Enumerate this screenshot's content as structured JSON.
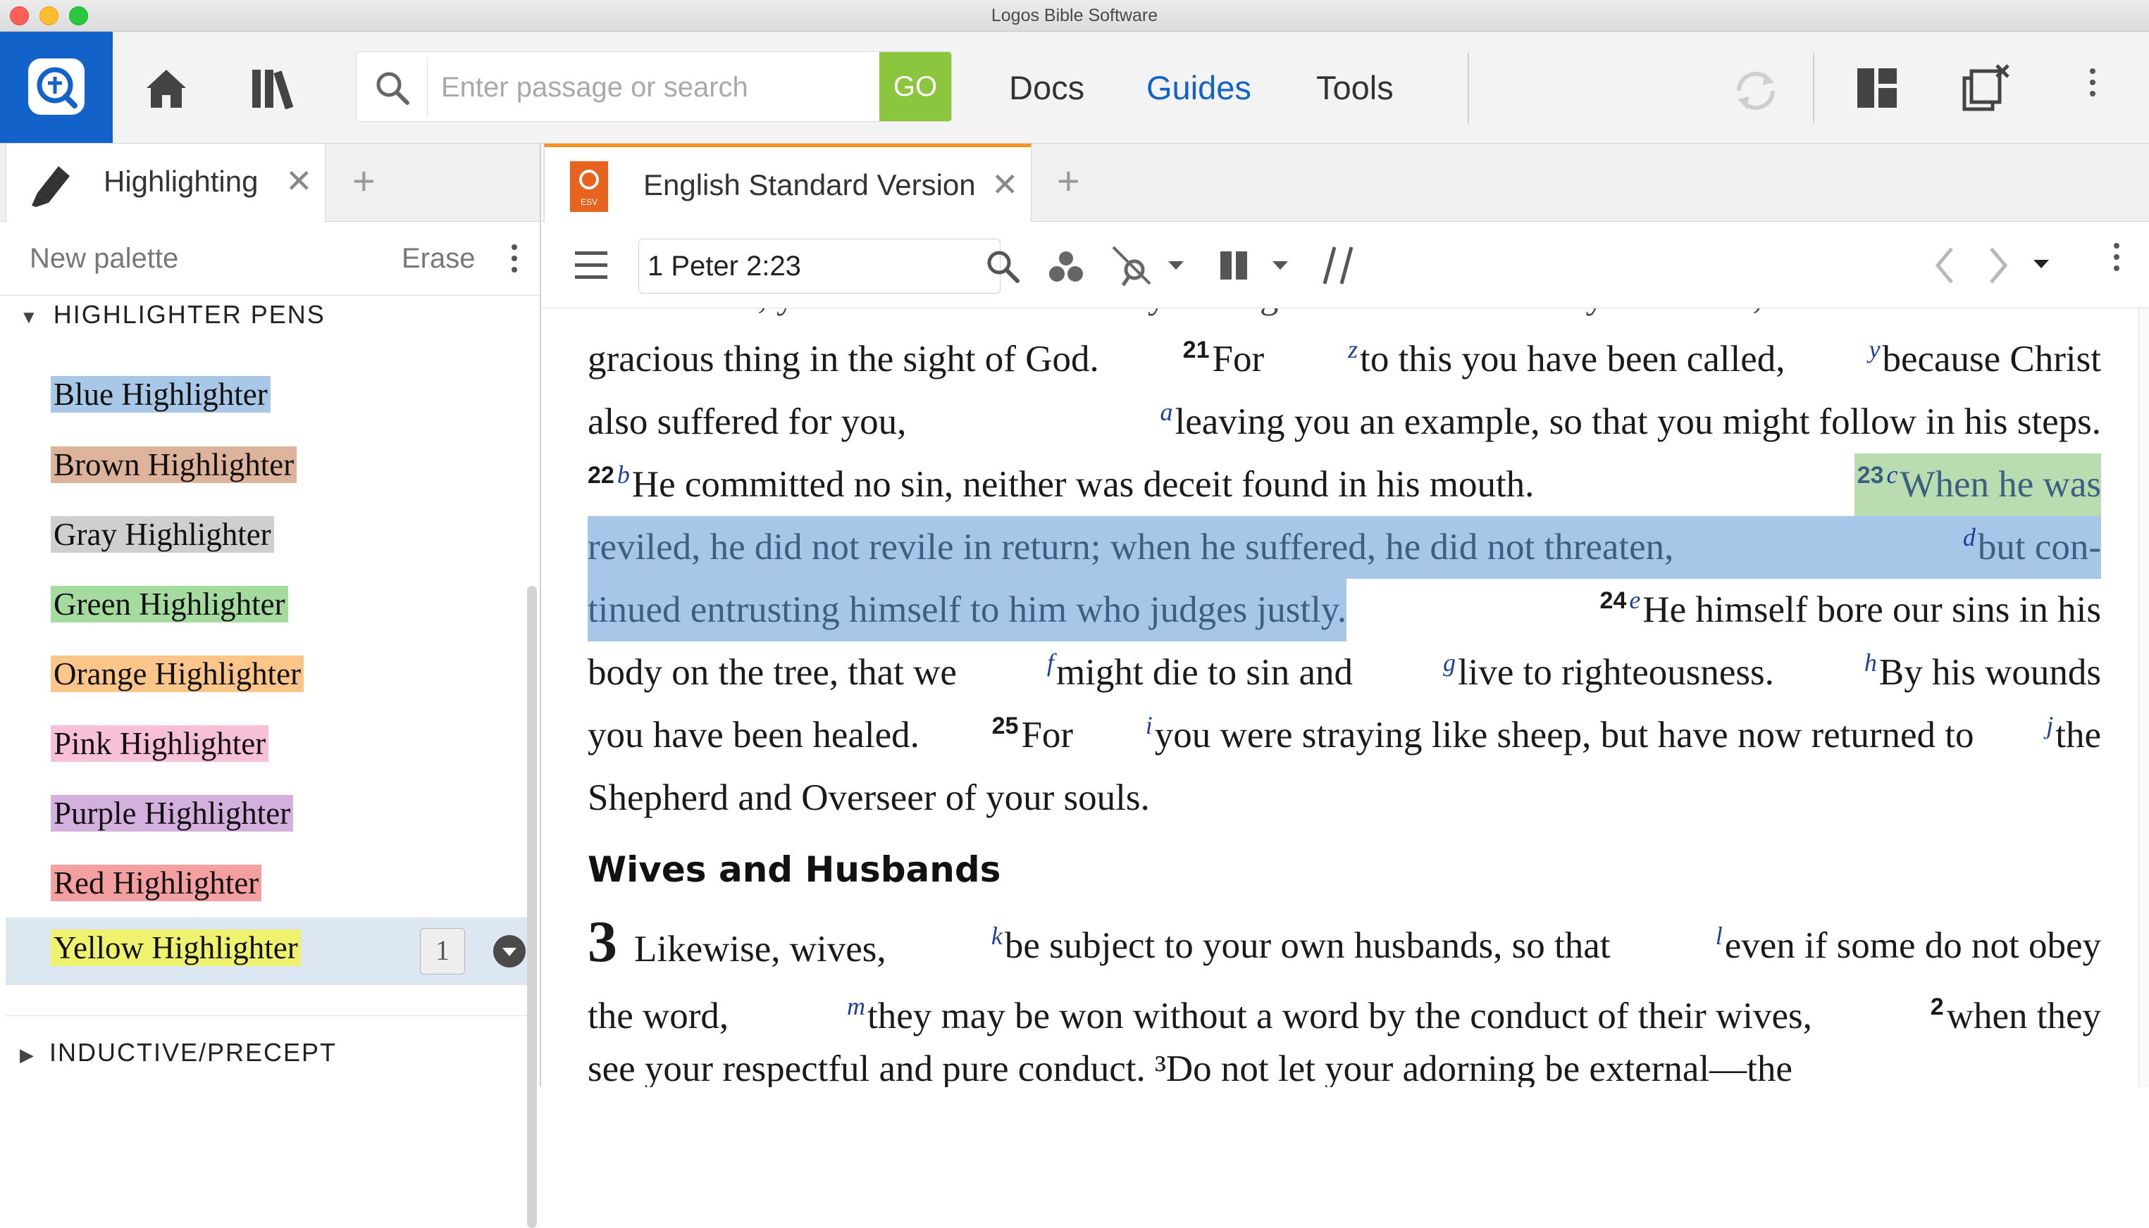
{
  "window": {
    "title": "Logos Bible Software"
  },
  "toolbar": {
    "search_placeholder": "Enter passage or search",
    "go_label": "GO",
    "menus": [
      {
        "label": "Docs",
        "active": false
      },
      {
        "label": "Guides",
        "active": true
      },
      {
        "label": "Tools",
        "active": false
      }
    ],
    "icons": [
      "logos-logo-icon",
      "home-icon",
      "library-icon",
      "search-icon",
      "sync-icon",
      "layout-icon",
      "close-panels-icon",
      "more-icon"
    ]
  },
  "left_panel": {
    "tab_label": "Highlighting",
    "new_palette": "New palette",
    "erase": "Erase",
    "section_pens": "HIGHLIGHTER PENS",
    "pens": [
      {
        "label": "Blue Highlighter",
        "color": "#a9c8e8"
      },
      {
        "label": "Brown Highlighter",
        "color": "#ddb39b"
      },
      {
        "label": "Gray Highlighter",
        "color": "#cfcfcf"
      },
      {
        "label": "Green Highlighter",
        "color": "#a6dba0"
      },
      {
        "label": "Orange Highlighter",
        "color": "#fcc58a"
      },
      {
        "label": "Pink Highlighter",
        "color": "#f8bfd9"
      },
      {
        "label": "Purple Highlighter",
        "color": "#d4b0de"
      },
      {
        "label": "Red Highlighter",
        "color": "#f5a0a0"
      },
      {
        "label": "Yellow Highlighter",
        "color": "#eef26e"
      }
    ],
    "selected_count": "1",
    "section_inductive": "INDUCTIVE/PRECEPT"
  },
  "right_panel": {
    "tab_label": "English Standard Version",
    "tab_badge": "ESV",
    "reference": "1 Peter 2:23",
    "lines": {
      "l1a": "gracious thing in the sight of God.",
      "v21": "21",
      "l1b": "For",
      "x_z": "z",
      "l1c": "to this you have been called,",
      "x_y": "y",
      "l1d": "because Christ",
      "l2a": "also suffered for you,",
      "x_a": "a",
      "l2b": "leaving you an example, so that you might follow in his steps.",
      "v22": "22",
      "x_b": "b",
      "l3a": "He committed no sin, neither was deceit found in his mouth.",
      "v23": "23",
      "x_c": "c",
      "l3b": "When he was",
      "l4a": "reviled, he did not revile in return; when he suffered, he did not threaten,",
      "x_d": "d",
      "l4b": "but con-",
      "l5a": "tinued entrusting himself to him who judges justly.",
      "v24": "24",
      "x_e": "e",
      "l5b": "He himself bore our sins in his",
      "l6a": "body on the tree, that we",
      "x_f": "f",
      "l6b": "might die to sin and",
      "x_g": "g",
      "l6c": "live to righteousness.",
      "x_h": "h",
      "l6d": "By his wounds",
      "l7a": "you have been healed.",
      "v25": "25",
      "l7b": "For",
      "x_i": "i",
      "l7c": "you were straying like sheep, but have now returned to",
      "x_j": "j",
      "l7d": "the",
      "l8a": "Shepherd and Overseer of your souls."
    },
    "heading": "Wives and Husbands",
    "chapter": "3",
    "c1a": "Likewise, wives,",
    "x_k": "k",
    "c1b": "be subject to your own husbands, so that",
    "x_l": "l",
    "c1c": "even if some do not obey",
    "c2a": "the word,",
    "x_m": "m",
    "c2b": "they may be won without a word by the conduct of their wives,",
    "v2": "2",
    "c2c": "when they"
  }
}
